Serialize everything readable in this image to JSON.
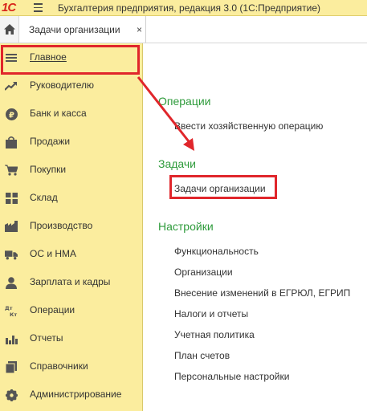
{
  "app": {
    "logo_text": "1С",
    "title": "Бухгалтерия предприятия, редакция 3.0  (1С:Предприятие)"
  },
  "tabs": [
    {
      "label": "Задачи организации",
      "close": "×"
    }
  ],
  "sidebar": {
    "items": [
      {
        "label": "Главное",
        "icon": "list-icon",
        "active": true
      },
      {
        "label": "Руководителю",
        "icon": "trend-icon"
      },
      {
        "label": "Банк и касса",
        "icon": "ruble-icon"
      },
      {
        "label": "Продажи",
        "icon": "bag-icon"
      },
      {
        "label": "Покупки",
        "icon": "cart-icon"
      },
      {
        "label": "Склад",
        "icon": "warehouse-icon"
      },
      {
        "label": "Производство",
        "icon": "factory-icon"
      },
      {
        "label": "ОС и НМА",
        "icon": "truck-icon"
      },
      {
        "label": "Зарплата и кадры",
        "icon": "person-icon"
      },
      {
        "label": "Операции",
        "icon": "dt-kt-icon"
      },
      {
        "label": "Отчеты",
        "icon": "bar-chart-icon"
      },
      {
        "label": "Справочники",
        "icon": "book-icon"
      },
      {
        "label": "Администрирование",
        "icon": "gear-icon"
      }
    ]
  },
  "content": {
    "sections": [
      {
        "title": "Операции",
        "links": [
          "Ввести хозяйственную операцию"
        ]
      },
      {
        "title": "Задачи",
        "links": [
          "Задачи организации"
        ]
      },
      {
        "title": "Настройки",
        "links": [
          "Функциональность",
          "Организации",
          "Внесение изменений в ЕГРЮЛ, ЕГРИП",
          "Налоги и отчеты",
          "Учетная политика",
          "План счетов",
          "Персональные настройки"
        ]
      }
    ]
  },
  "colors": {
    "sidebar_bg": "#fbed9e",
    "section_title": "#2e9b3b",
    "highlight": "#e0262b",
    "logo": "#d8261c"
  }
}
